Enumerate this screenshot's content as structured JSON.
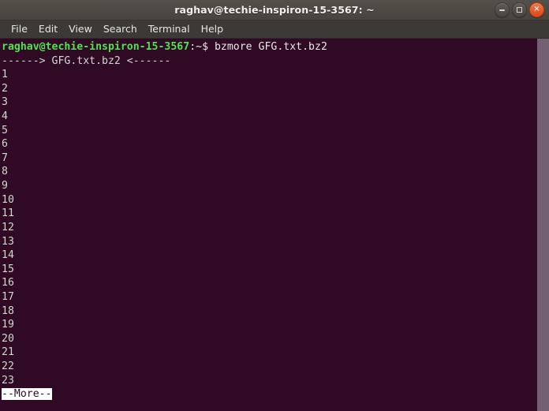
{
  "window": {
    "title": "raghav@techie-inspiron-15-3567: ~",
    "controls": {
      "minimize_label": "–",
      "maximize_label": "□",
      "close_label": "✕"
    },
    "colors": {
      "titlebar_bg": "#4f4c47",
      "menubar_bg": "#3c3a35",
      "terminal_bg": "#300a24",
      "prompt_green": "#4ee44e",
      "text_white": "#d3d7cf",
      "close_orange": "#dd4814",
      "scrollbar": "#806e7e"
    }
  },
  "menubar": {
    "items": [
      {
        "label": "File"
      },
      {
        "label": "Edit"
      },
      {
        "label": "View"
      },
      {
        "label": "Search"
      },
      {
        "label": "Terminal"
      },
      {
        "label": "Help"
      }
    ]
  },
  "terminal": {
    "prompt": {
      "user_host": "raghav@techie-inspiron-15-3567",
      "path_sigil": ":~$",
      "command": "bzmore GFG.txt.bz2"
    },
    "file_banner": "------> GFG.txt.bz2 <------",
    "line_numbers": [
      "1",
      "2",
      "3",
      "4",
      "5",
      "6",
      "7",
      "8",
      "9",
      "10",
      "11",
      "12",
      "13",
      "14",
      "15",
      "16",
      "17",
      "18",
      "19",
      "20",
      "21",
      "22",
      "23"
    ],
    "pager_status": "--More--"
  }
}
